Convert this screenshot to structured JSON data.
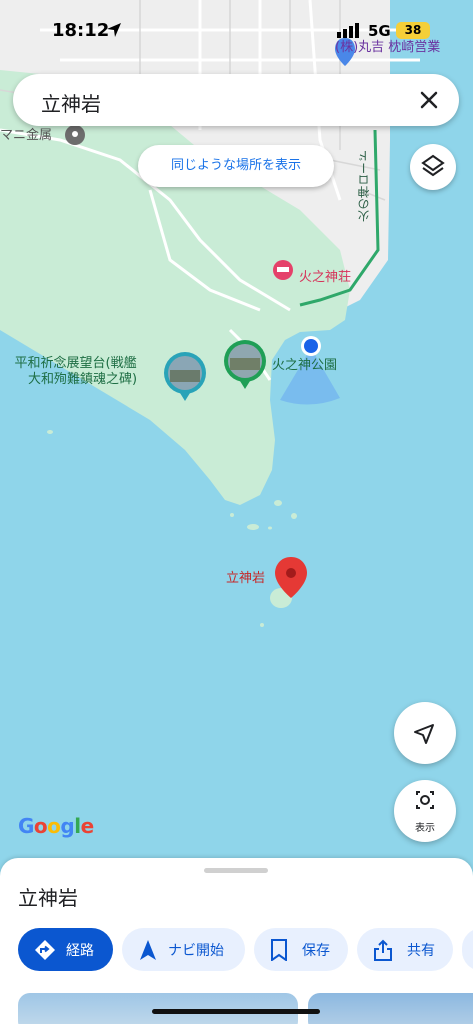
{
  "status_bar": {
    "time": "18:12",
    "network": "5G",
    "battery": "38",
    "poi_label": "(株)丸吉 枕崎営業"
  },
  "search": {
    "query": "立神岩"
  },
  "map": {
    "similar_button": "同じような場所を表示",
    "labels": {
      "mani": "マニ金属",
      "road": "火の神ロード",
      "hinokami_so": "火之神荘",
      "hinokami_park": "火之神公園",
      "observatory_line1": "平和祈念展望台(戦艦",
      "observatory_line2": "大和殉難鎮魂之碑)",
      "tategamiiwa": "立神岩"
    },
    "google_logo": "Google",
    "lens_label": "表示",
    "colors": {
      "water": "#8fd5ea",
      "land": "#c9ecd6",
      "pin": "#e53935",
      "route": "#2fa86a"
    }
  },
  "sheet": {
    "title": "立神岩",
    "actions": [
      {
        "label": "経路",
        "icon": "directions-icon"
      },
      {
        "label": "ナビ開始",
        "icon": "navigation-arrow-icon"
      },
      {
        "label": "保存",
        "icon": "bookmark-icon"
      },
      {
        "label": "共有",
        "icon": "share-icon"
      }
    ]
  }
}
